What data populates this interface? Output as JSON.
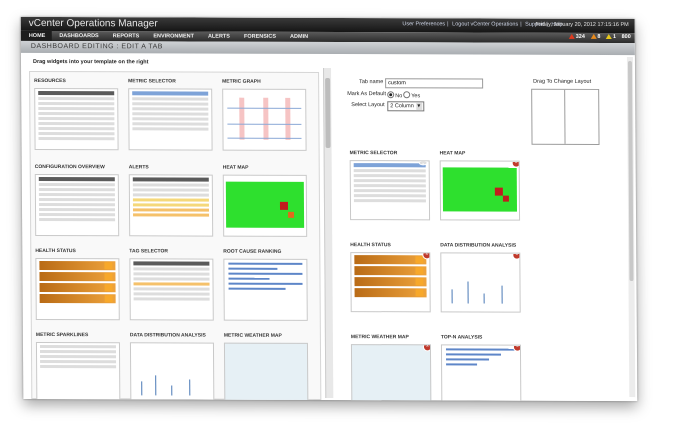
{
  "app": {
    "title": "vCenter Operations Manager",
    "links": [
      "User Preferences",
      "Logout vCenter Operations",
      "Support",
      "Help"
    ],
    "date": "Friday, January 20, 2012 17:15:16 PM"
  },
  "nav": {
    "tabs": [
      "HOME",
      "DASHBOARDS",
      "REPORTS",
      "ENVIRONMENT",
      "ALERTS",
      "FORENSICS",
      "ADMIN"
    ],
    "alert_counts": {
      "critical": "324",
      "immediate": "8",
      "warning": "1",
      "info": "800"
    }
  },
  "breadcrumb": "DASHBOARD EDITING : EDIT A TAB",
  "left": {
    "hint": "Drag widgets into your template on the right",
    "widgets": [
      {
        "label": "RESOURCES"
      },
      {
        "label": "METRIC SELECTOR"
      },
      {
        "label": "METRIC GRAPH"
      },
      {
        "label": "CONFIGURATION OVERVIEW"
      },
      {
        "label": "ALERTS"
      },
      {
        "label": "HEAT MAP"
      },
      {
        "label": "HEALTH STATUS"
      },
      {
        "label": "TAG SELECTOR"
      },
      {
        "label": "ROOT CAUSE RANKING"
      },
      {
        "label": "METRIC SPARKLINES"
      },
      {
        "label": "DATA DISTRIBUTION ANALYSIS"
      },
      {
        "label": "METRIC WEATHER MAP"
      }
    ]
  },
  "right": {
    "tab_name_label": "Tab name",
    "tab_name_value": "custom",
    "mark_default_label": "Mark As Default",
    "no_label": "No",
    "yes_label": "Yes",
    "select_layout_label": "Select Layout",
    "layout_value": "2 Column",
    "drag_layout_caption": "Drag To Change Layout",
    "placed_widgets": [
      {
        "label": "METRIC SELECTOR"
      },
      {
        "label": "HEAT MAP"
      },
      {
        "label": "HEALTH STATUS"
      },
      {
        "label": "DATA DISTRIBUTION ANALYSIS"
      },
      {
        "label": "METRIC WEATHER MAP"
      },
      {
        "label": "TOP-N ANALYSIS"
      }
    ]
  },
  "colors": {
    "accent_red": "#c21d1d",
    "heat_green": "#2ee02e",
    "health_orange": "#eea33c"
  }
}
